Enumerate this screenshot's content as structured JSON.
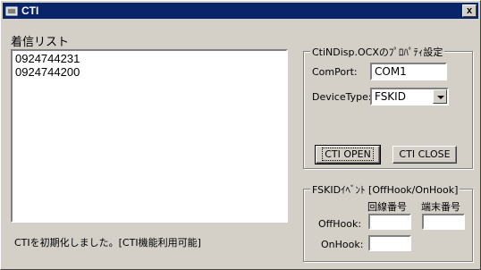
{
  "window": {
    "title": "CTI",
    "close_label": "x"
  },
  "incoming": {
    "label": "着信リスト",
    "items": [
      "0924744231",
      "0924744200"
    ]
  },
  "props": {
    "group_title": "CtiNDisp.OCXのﾌﾟﾛﾊﾟﾃｨ設定",
    "comport_label": "ComPort:",
    "comport_value": "COM1",
    "devicetype_label": "DeviceType:",
    "devicetype_value": "FSKID",
    "open_label": "CTI OPEN",
    "close_label": "CTI CLOSE"
  },
  "fskid": {
    "group_title": "FSKIDｲﾍﾞﾝﾄ [OffHook/OnHook]",
    "col_line": "回線番号",
    "col_terminal": "端末番号",
    "offhook_label": "OffHook:",
    "onhook_label": "OnHook:",
    "offhook_line": "",
    "offhook_terminal": "",
    "onhook_line": ""
  },
  "status": "CTIを初期化しました。[CTI機能利用可能]"
}
